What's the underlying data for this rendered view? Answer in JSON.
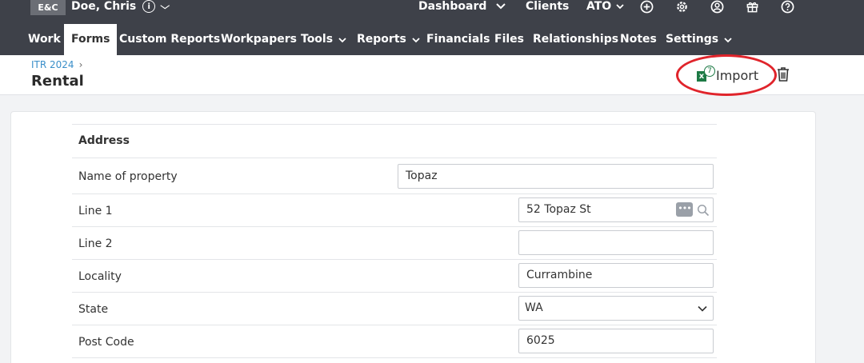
{
  "topbar": {
    "logo": "E&C",
    "client_name": "Doe, Chris",
    "info_glyph": "i",
    "dashboard": "Dashboard",
    "clients": "Clients",
    "ato": "ATO",
    "icons": [
      "plus-circle-icon",
      "gear-icon",
      "user-circle-icon",
      "gift-icon",
      "help-circle-icon"
    ]
  },
  "menu": {
    "items": [
      {
        "label": "Work"
      },
      {
        "label": "Forms",
        "active": true
      },
      {
        "label": "Custom Reports"
      },
      {
        "label": "Workpapers"
      },
      {
        "label": "Tools",
        "dropdown": true
      },
      {
        "label": "Reports",
        "dropdown": true
      },
      {
        "label": "Financials"
      },
      {
        "label": "Files"
      },
      {
        "label": "Relationships"
      },
      {
        "label": "Notes"
      },
      {
        "label": "Settings",
        "dropdown": true
      }
    ]
  },
  "page": {
    "breadcrumb": "ITR 2024",
    "breadcrumb_sep": "›",
    "title": "Rental",
    "import_label": "Import",
    "import_badge": "7",
    "excel_letter": "x",
    "highlight_color": "#e0242b"
  },
  "form": {
    "section": "Address",
    "fields": {
      "name_of_property": {
        "label": "Name of property",
        "value": "Topaz"
      },
      "line1": {
        "label": "Line 1",
        "value": "52 Topaz St"
      },
      "line2": {
        "label": "Line 2",
        "value": ""
      },
      "locality": {
        "label": "Locality",
        "value": "Currambine"
      },
      "state": {
        "label": "State",
        "value": "WA"
      },
      "post_code": {
        "label": "Post Code",
        "value": "6025"
      }
    }
  }
}
